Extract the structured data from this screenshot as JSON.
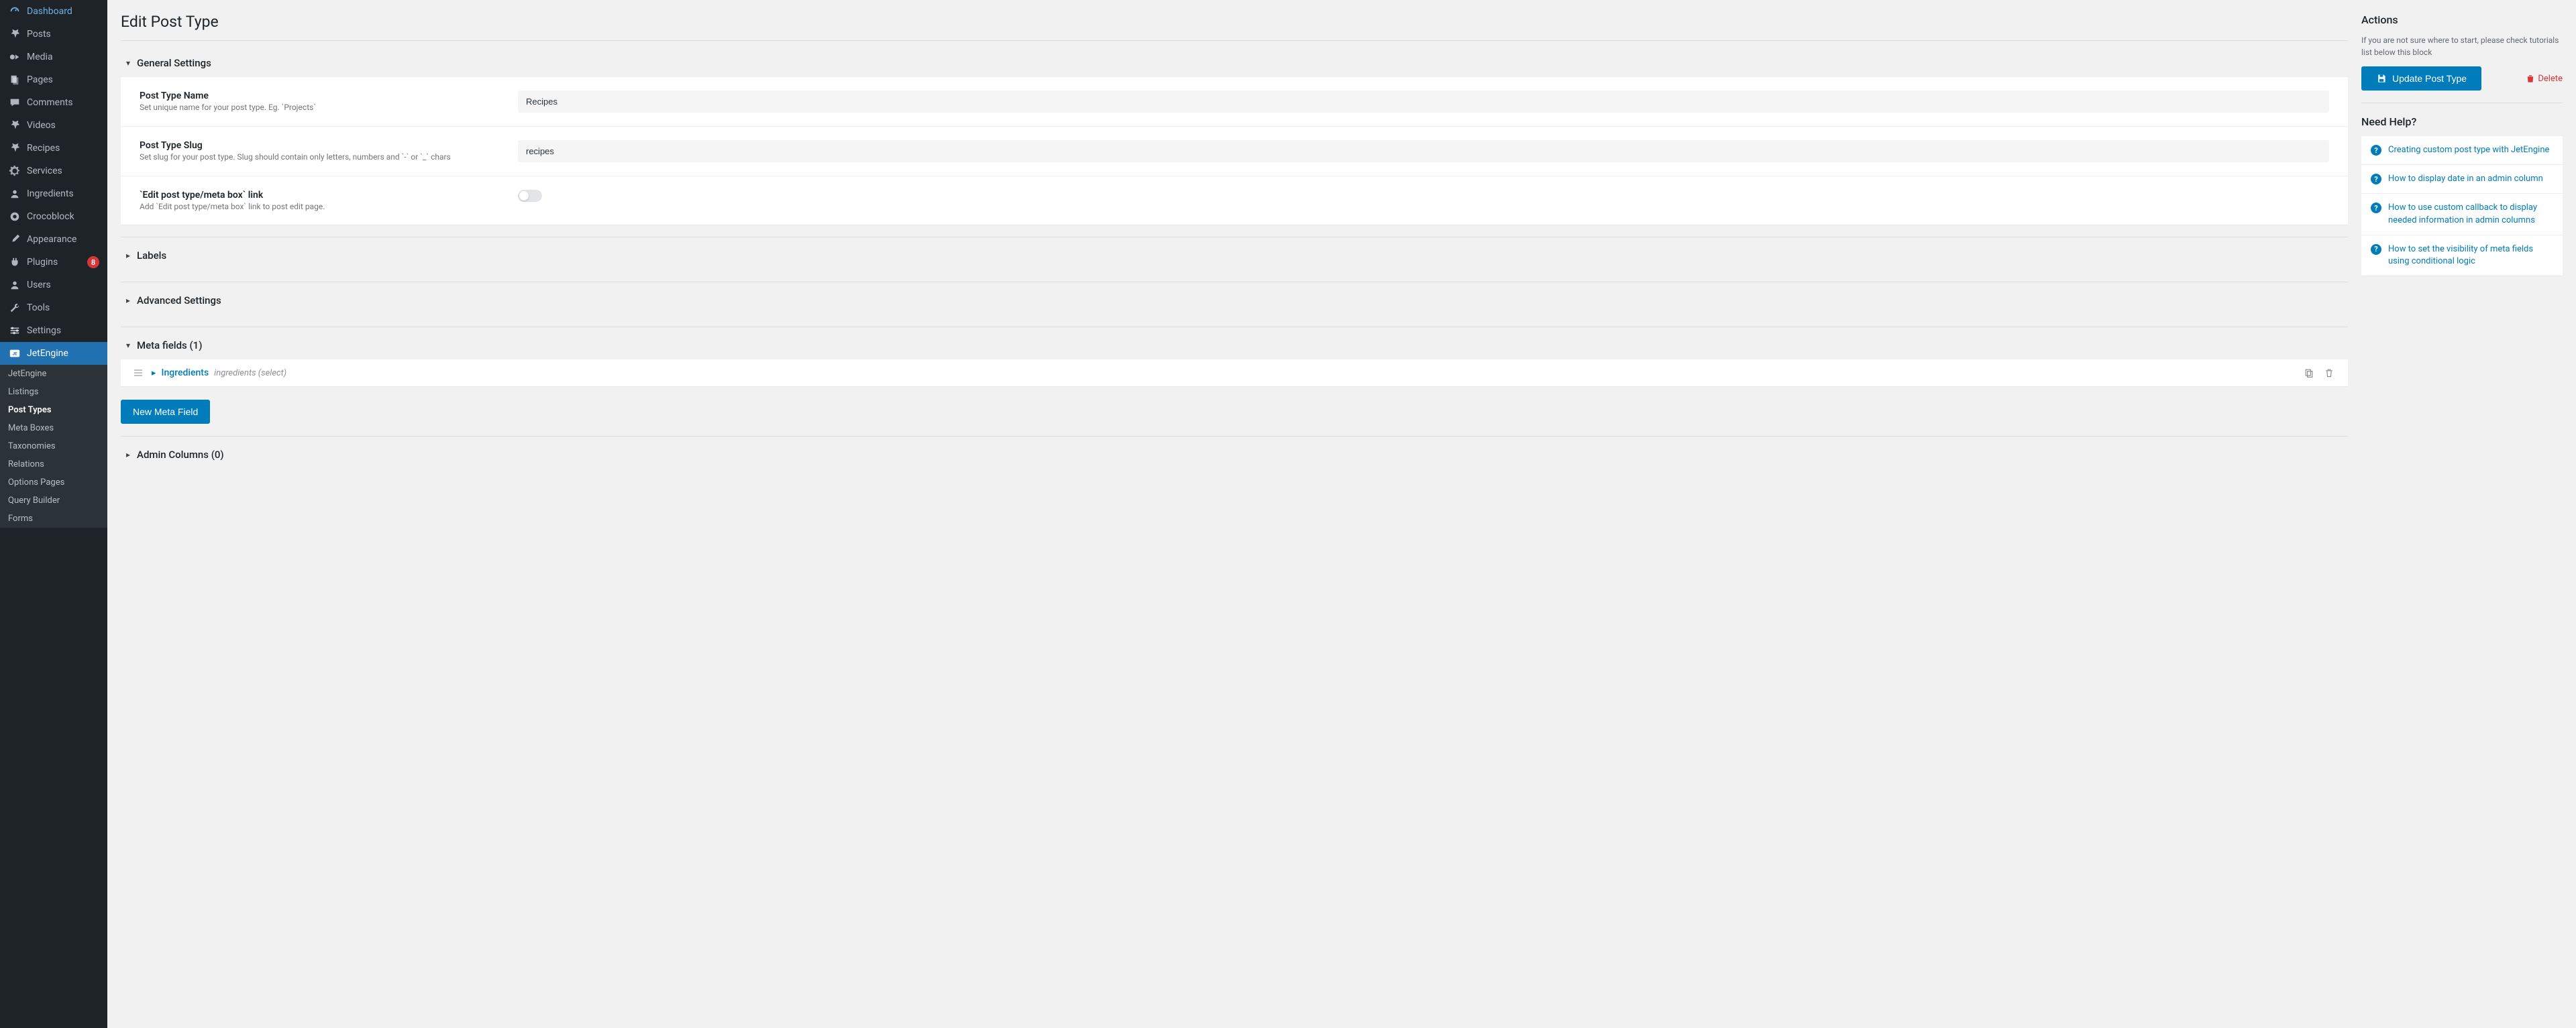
{
  "sidebar": {
    "items": [
      {
        "label": "Dashboard",
        "icon": "gauge"
      },
      {
        "label": "Posts",
        "icon": "pin"
      },
      {
        "label": "Media",
        "icon": "media"
      },
      {
        "label": "Pages",
        "icon": "pages"
      },
      {
        "label": "Comments",
        "icon": "comment"
      },
      {
        "label": "Videos",
        "icon": "pin"
      },
      {
        "label": "Recipes",
        "icon": "pin"
      },
      {
        "label": "Services",
        "icon": "gear"
      },
      {
        "label": "Ingredients",
        "icon": "user"
      },
      {
        "label": "Crocoblock",
        "icon": "croco"
      },
      {
        "label": "Appearance",
        "icon": "brush"
      },
      {
        "label": "Plugins",
        "icon": "plug",
        "badge": "8"
      },
      {
        "label": "Users",
        "icon": "user"
      },
      {
        "label": "Tools",
        "icon": "wrench"
      },
      {
        "label": "Settings",
        "icon": "sliders"
      },
      {
        "label": "JetEngine",
        "icon": "je",
        "active": true
      }
    ],
    "submenu": [
      {
        "label": "JetEngine"
      },
      {
        "label": "Listings"
      },
      {
        "label": "Post Types",
        "current": true
      },
      {
        "label": "Meta Boxes"
      },
      {
        "label": "Taxonomies"
      },
      {
        "label": "Relations"
      },
      {
        "label": "Options Pages"
      },
      {
        "label": "Query Builder"
      },
      {
        "label": "Forms"
      }
    ]
  },
  "page": {
    "title": "Edit Post Type"
  },
  "general": {
    "title": "General Settings",
    "name": {
      "label": "Post Type Name",
      "help": "Set unique name for your post type. Eg. `Projects`",
      "value": "Recipes"
    },
    "slug": {
      "label": "Post Type Slug",
      "help": "Set slug for your post type. Slug should contain only letters, numbers and `-` or `_` chars",
      "value": "recipes"
    },
    "editlink": {
      "label": "`Edit post type/meta box` link",
      "help": "Add `Edit post type/meta box` link to post edit page."
    }
  },
  "labels": {
    "title": "Labels"
  },
  "advanced": {
    "title": "Advanced Settings"
  },
  "metafields": {
    "title": "Meta fields (1)",
    "item": {
      "label": "Ingredients",
      "type": "ingredients (select)"
    },
    "new_btn": "New Meta Field"
  },
  "admincols": {
    "title": "Admin Columns (0)"
  },
  "right": {
    "actions_title": "Actions",
    "actions_help": "If you are not sure where to start, please check tutorials list below this block",
    "update_btn": "Update Post Type",
    "delete": "Delete",
    "need_help": "Need Help?",
    "links": [
      "Creating custom post type with JetEngine",
      "How to display date in an admin column",
      "How to use custom callback to display needed information in admin columns",
      "How to set the visibility of meta fields using conditional logic"
    ]
  }
}
